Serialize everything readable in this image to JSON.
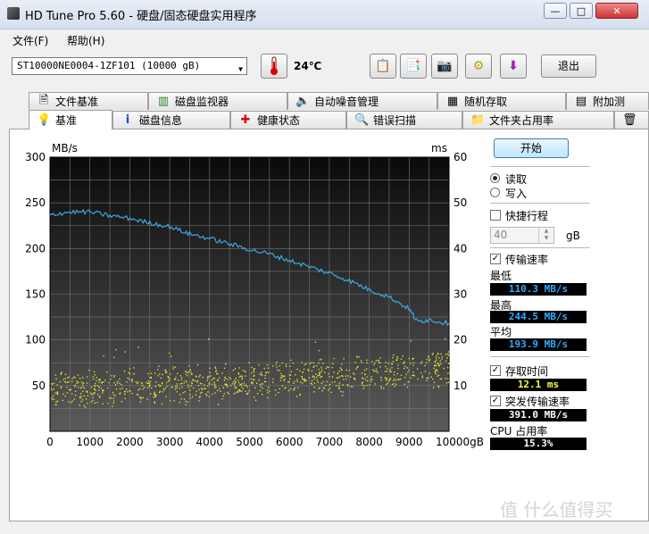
{
  "window": {
    "title": "HD Tune Pro 5.60 - 硬盘/固态硬盘实用程序",
    "minimize": "—",
    "maximize": "□",
    "close": "✕"
  },
  "menu": {
    "file": "文件(F)",
    "help": "帮助(H)"
  },
  "toolbar": {
    "drive": "ST10000NE0004-1ZF101 (10000 gB)",
    "temperature": "24℃",
    "exit_label": "退出",
    "icons": [
      "copy-icon",
      "copy-list-icon",
      "camera-icon",
      "options-icon",
      "download-icon"
    ]
  },
  "tabs": {
    "row1": [
      "文件基准",
      "磁盘监视器",
      "自动噪音管理",
      "随机存取",
      "附加测"
    ],
    "row2": [
      "基准",
      "磁盘信息",
      "健康状态",
      "错误扫描",
      "文件夹占用率"
    ],
    "active": "基准"
  },
  "side": {
    "start": "开始",
    "read": "读取",
    "write": "写入",
    "short_stroke": "快捷行程",
    "stroke_value": "40",
    "stroke_unit": "gB",
    "transfer_rate": "传输速率",
    "min_label": "最低",
    "min_value": "110.3 MB/s",
    "max_label": "最高",
    "max_value": "244.5 MB/s",
    "avg_label": "平均",
    "avg_value": "193.9 MB/s",
    "access_time": "存取时间",
    "access_value": "12.1 ms",
    "burst_rate": "突发传输速率",
    "burst_value": "391.0 MB/s",
    "cpu_label": "CPU 占用率",
    "cpu_value": "15.3%"
  },
  "colors": {
    "transfer_line": "#3fa7e0",
    "access_dots": "#f2f233",
    "readout_blue": "#33aaff",
    "readout_yellow": "#ffff33",
    "readout_white": "#ffffff"
  },
  "chart_data": {
    "type": "line",
    "y_left_label": "MB/s",
    "y_right_label": "ms",
    "x_unit": "gB",
    "ylim_left": [
      0,
      300
    ],
    "ylim_right": [
      0,
      60
    ],
    "xlim": [
      0,
      10000
    ],
    "y_left_ticks": [
      300,
      250,
      200,
      150,
      100,
      50
    ],
    "y_right_ticks": [
      60,
      50,
      40,
      30,
      20,
      10
    ],
    "x_ticks": [
      "0",
      "1000",
      "2000",
      "3000",
      "4000",
      "5000",
      "6000",
      "7000",
      "8000",
      "9000",
      "10000gB"
    ],
    "grid": true,
    "series": [
      {
        "name": "传输速率",
        "x": [
          0,
          500,
          1000,
          1500,
          2000,
          2500,
          3000,
          3500,
          4000,
          4500,
          5000,
          5500,
          6000,
          6500,
          7000,
          7500,
          8000,
          8500,
          9000,
          9200,
          9500,
          10000
        ],
        "values": [
          237,
          240,
          240,
          236,
          233,
          228,
          224,
          216,
          211,
          205,
          199,
          194,
          187,
          180,
          173,
          165,
          155,
          147,
          134,
          120,
          122,
          118
        ]
      },
      {
        "name": "存取时间",
        "type": "scatter",
        "x_range": [
          0,
          10000
        ],
        "values_range_ms": [
          5,
          21
        ],
        "band_ms": [
          [
            0,
            9
          ],
          [
            5000,
            11
          ],
          [
            10000,
            14
          ]
        ]
      }
    ]
  }
}
